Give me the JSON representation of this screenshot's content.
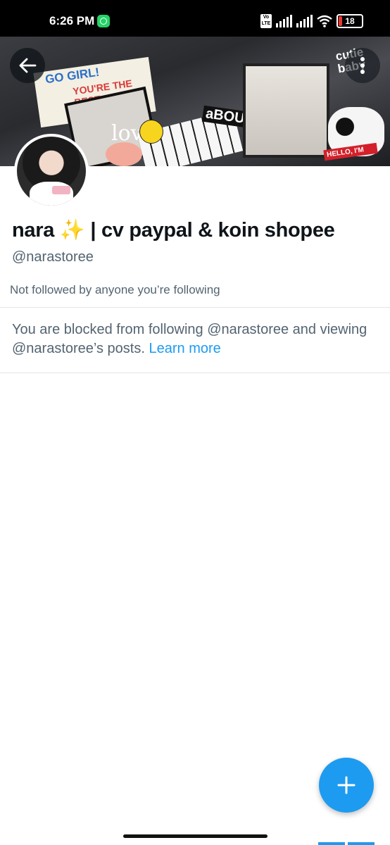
{
  "status_bar": {
    "time": "6:26 PM",
    "volte_label": "Vo LTE",
    "battery_level": "18",
    "icons": [
      "whatsapp-icon",
      "volte-icon",
      "signal-icon",
      "signal-icon",
      "wifi-icon",
      "battery-icon"
    ]
  },
  "header": {
    "back_icon": "arrow-left-icon",
    "more_icon": "more-vertical-icon"
  },
  "banner": {
    "texts": [
      "GO GIRL!",
      "YOU'RE THE BEST",
      "love",
      "aBOU",
      "cutie baby",
      "HELLO, I'M"
    ]
  },
  "profile": {
    "display_name": "nara ✨ | cv paypal & koin shopee",
    "handle": "@narastoree",
    "followed_by": "Not followed by anyone you’re following",
    "blocked_text": "You are blocked from following @narastoree and viewing @narastoree’s posts.",
    "learn_more": "Learn more"
  },
  "fab": {
    "icon": "plus-icon"
  },
  "colors": {
    "accent": "#1d9bf0",
    "secondary_text": "#536471",
    "primary_text": "#0f1419",
    "divider": "#e1e5e9"
  }
}
